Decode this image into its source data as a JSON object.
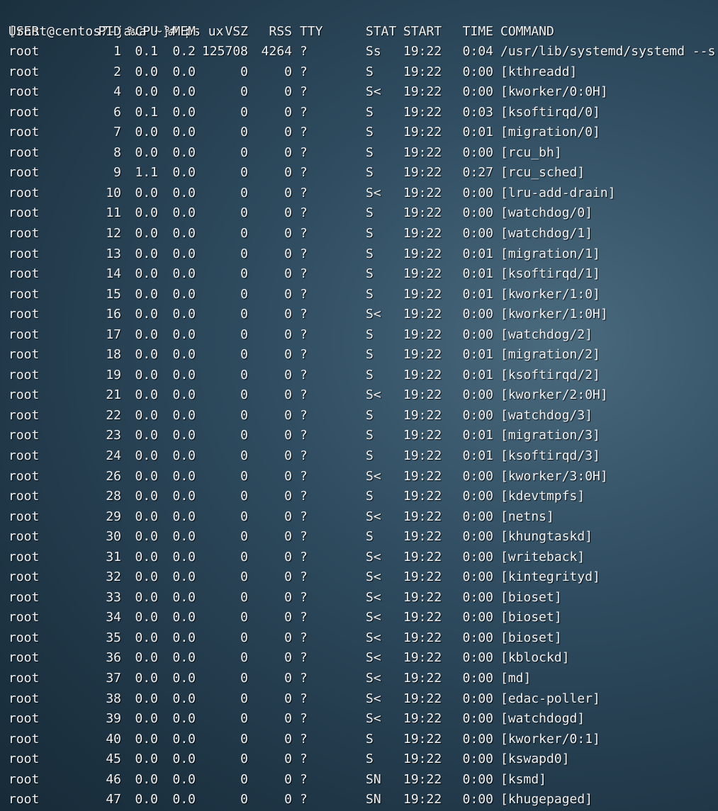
{
  "prompt": "[root@centos7-java ~]# ps ux",
  "headers": {
    "user": "USER",
    "pid": "PID",
    "cpu": "%CPU",
    "mem": "%MEM",
    "vsz": "VSZ",
    "rss": "RSS",
    "tty": "TTY",
    "stat": "STAT",
    "start": "START",
    "time": "TIME",
    "command": "COMMAND"
  },
  "rows": [
    {
      "user": "root",
      "pid": "1",
      "cpu": "0.1",
      "mem": "0.2",
      "vsz": "125708",
      "rss": "4264",
      "tty": "?",
      "stat": "Ss",
      "start": "19:22",
      "time": "0:04",
      "command": "/usr/lib/systemd/systemd --s"
    },
    {
      "user": "root",
      "pid": "2",
      "cpu": "0.0",
      "mem": "0.0",
      "vsz": "0",
      "rss": "0",
      "tty": "?",
      "stat": "S",
      "start": "19:22",
      "time": "0:00",
      "command": "[kthreadd]"
    },
    {
      "user": "root",
      "pid": "4",
      "cpu": "0.0",
      "mem": "0.0",
      "vsz": "0",
      "rss": "0",
      "tty": "?",
      "stat": "S<",
      "start": "19:22",
      "time": "0:00",
      "command": "[kworker/0:0H]"
    },
    {
      "user": "root",
      "pid": "6",
      "cpu": "0.1",
      "mem": "0.0",
      "vsz": "0",
      "rss": "0",
      "tty": "?",
      "stat": "S",
      "start": "19:22",
      "time": "0:03",
      "command": "[ksoftirqd/0]"
    },
    {
      "user": "root",
      "pid": "7",
      "cpu": "0.0",
      "mem": "0.0",
      "vsz": "0",
      "rss": "0",
      "tty": "?",
      "stat": "S",
      "start": "19:22",
      "time": "0:01",
      "command": "[migration/0]"
    },
    {
      "user": "root",
      "pid": "8",
      "cpu": "0.0",
      "mem": "0.0",
      "vsz": "0",
      "rss": "0",
      "tty": "?",
      "stat": "S",
      "start": "19:22",
      "time": "0:00",
      "command": "[rcu_bh]"
    },
    {
      "user": "root",
      "pid": "9",
      "cpu": "1.1",
      "mem": "0.0",
      "vsz": "0",
      "rss": "0",
      "tty": "?",
      "stat": "S",
      "start": "19:22",
      "time": "0:27",
      "command": "[rcu_sched]"
    },
    {
      "user": "root",
      "pid": "10",
      "cpu": "0.0",
      "mem": "0.0",
      "vsz": "0",
      "rss": "0",
      "tty": "?",
      "stat": "S<",
      "start": "19:22",
      "time": "0:00",
      "command": "[lru-add-drain]"
    },
    {
      "user": "root",
      "pid": "11",
      "cpu": "0.0",
      "mem": "0.0",
      "vsz": "0",
      "rss": "0",
      "tty": "?",
      "stat": "S",
      "start": "19:22",
      "time": "0:00",
      "command": "[watchdog/0]"
    },
    {
      "user": "root",
      "pid": "12",
      "cpu": "0.0",
      "mem": "0.0",
      "vsz": "0",
      "rss": "0",
      "tty": "?",
      "stat": "S",
      "start": "19:22",
      "time": "0:00",
      "command": "[watchdog/1]"
    },
    {
      "user": "root",
      "pid": "13",
      "cpu": "0.0",
      "mem": "0.0",
      "vsz": "0",
      "rss": "0",
      "tty": "?",
      "stat": "S",
      "start": "19:22",
      "time": "0:01",
      "command": "[migration/1]"
    },
    {
      "user": "root",
      "pid": "14",
      "cpu": "0.0",
      "mem": "0.0",
      "vsz": "0",
      "rss": "0",
      "tty": "?",
      "stat": "S",
      "start": "19:22",
      "time": "0:01",
      "command": "[ksoftirqd/1]"
    },
    {
      "user": "root",
      "pid": "15",
      "cpu": "0.0",
      "mem": "0.0",
      "vsz": "0",
      "rss": "0",
      "tty": "?",
      "stat": "S",
      "start": "19:22",
      "time": "0:01",
      "command": "[kworker/1:0]"
    },
    {
      "user": "root",
      "pid": "16",
      "cpu": "0.0",
      "mem": "0.0",
      "vsz": "0",
      "rss": "0",
      "tty": "?",
      "stat": "S<",
      "start": "19:22",
      "time": "0:00",
      "command": "[kworker/1:0H]"
    },
    {
      "user": "root",
      "pid": "17",
      "cpu": "0.0",
      "mem": "0.0",
      "vsz": "0",
      "rss": "0",
      "tty": "?",
      "stat": "S",
      "start": "19:22",
      "time": "0:00",
      "command": "[watchdog/2]"
    },
    {
      "user": "root",
      "pid": "18",
      "cpu": "0.0",
      "mem": "0.0",
      "vsz": "0",
      "rss": "0",
      "tty": "?",
      "stat": "S",
      "start": "19:22",
      "time": "0:01",
      "command": "[migration/2]"
    },
    {
      "user": "root",
      "pid": "19",
      "cpu": "0.0",
      "mem": "0.0",
      "vsz": "0",
      "rss": "0",
      "tty": "?",
      "stat": "S",
      "start": "19:22",
      "time": "0:01",
      "command": "[ksoftirqd/2]"
    },
    {
      "user": "root",
      "pid": "21",
      "cpu": "0.0",
      "mem": "0.0",
      "vsz": "0",
      "rss": "0",
      "tty": "?",
      "stat": "S<",
      "start": "19:22",
      "time": "0:00",
      "command": "[kworker/2:0H]"
    },
    {
      "user": "root",
      "pid": "22",
      "cpu": "0.0",
      "mem": "0.0",
      "vsz": "0",
      "rss": "0",
      "tty": "?",
      "stat": "S",
      "start": "19:22",
      "time": "0:00",
      "command": "[watchdog/3]"
    },
    {
      "user": "root",
      "pid": "23",
      "cpu": "0.0",
      "mem": "0.0",
      "vsz": "0",
      "rss": "0",
      "tty": "?",
      "stat": "S",
      "start": "19:22",
      "time": "0:01",
      "command": "[migration/3]"
    },
    {
      "user": "root",
      "pid": "24",
      "cpu": "0.0",
      "mem": "0.0",
      "vsz": "0",
      "rss": "0",
      "tty": "?",
      "stat": "S",
      "start": "19:22",
      "time": "0:01",
      "command": "[ksoftirqd/3]"
    },
    {
      "user": "root",
      "pid": "26",
      "cpu": "0.0",
      "mem": "0.0",
      "vsz": "0",
      "rss": "0",
      "tty": "?",
      "stat": "S<",
      "start": "19:22",
      "time": "0:00",
      "command": "[kworker/3:0H]"
    },
    {
      "user": "root",
      "pid": "28",
      "cpu": "0.0",
      "mem": "0.0",
      "vsz": "0",
      "rss": "0",
      "tty": "?",
      "stat": "S",
      "start": "19:22",
      "time": "0:00",
      "command": "[kdevtmpfs]"
    },
    {
      "user": "root",
      "pid": "29",
      "cpu": "0.0",
      "mem": "0.0",
      "vsz": "0",
      "rss": "0",
      "tty": "?",
      "stat": "S<",
      "start": "19:22",
      "time": "0:00",
      "command": "[netns]"
    },
    {
      "user": "root",
      "pid": "30",
      "cpu": "0.0",
      "mem": "0.0",
      "vsz": "0",
      "rss": "0",
      "tty": "?",
      "stat": "S",
      "start": "19:22",
      "time": "0:00",
      "command": "[khungtaskd]"
    },
    {
      "user": "root",
      "pid": "31",
      "cpu": "0.0",
      "mem": "0.0",
      "vsz": "0",
      "rss": "0",
      "tty": "?",
      "stat": "S<",
      "start": "19:22",
      "time": "0:00",
      "command": "[writeback]"
    },
    {
      "user": "root",
      "pid": "32",
      "cpu": "0.0",
      "mem": "0.0",
      "vsz": "0",
      "rss": "0",
      "tty": "?",
      "stat": "S<",
      "start": "19:22",
      "time": "0:00",
      "command": "[kintegrityd]"
    },
    {
      "user": "root",
      "pid": "33",
      "cpu": "0.0",
      "mem": "0.0",
      "vsz": "0",
      "rss": "0",
      "tty": "?",
      "stat": "S<",
      "start": "19:22",
      "time": "0:00",
      "command": "[bioset]"
    },
    {
      "user": "root",
      "pid": "34",
      "cpu": "0.0",
      "mem": "0.0",
      "vsz": "0",
      "rss": "0",
      "tty": "?",
      "stat": "S<",
      "start": "19:22",
      "time": "0:00",
      "command": "[bioset]"
    },
    {
      "user": "root",
      "pid": "35",
      "cpu": "0.0",
      "mem": "0.0",
      "vsz": "0",
      "rss": "0",
      "tty": "?",
      "stat": "S<",
      "start": "19:22",
      "time": "0:00",
      "command": "[bioset]"
    },
    {
      "user": "root",
      "pid": "36",
      "cpu": "0.0",
      "mem": "0.0",
      "vsz": "0",
      "rss": "0",
      "tty": "?",
      "stat": "S<",
      "start": "19:22",
      "time": "0:00",
      "command": "[kblockd]"
    },
    {
      "user": "root",
      "pid": "37",
      "cpu": "0.0",
      "mem": "0.0",
      "vsz": "0",
      "rss": "0",
      "tty": "?",
      "stat": "S<",
      "start": "19:22",
      "time": "0:00",
      "command": "[md]"
    },
    {
      "user": "root",
      "pid": "38",
      "cpu": "0.0",
      "mem": "0.0",
      "vsz": "0",
      "rss": "0",
      "tty": "?",
      "stat": "S<",
      "start": "19:22",
      "time": "0:00",
      "command": "[edac-poller]"
    },
    {
      "user": "root",
      "pid": "39",
      "cpu": "0.0",
      "mem": "0.0",
      "vsz": "0",
      "rss": "0",
      "tty": "?",
      "stat": "S<",
      "start": "19:22",
      "time": "0:00",
      "command": "[watchdogd]"
    },
    {
      "user": "root",
      "pid": "40",
      "cpu": "0.0",
      "mem": "0.0",
      "vsz": "0",
      "rss": "0",
      "tty": "?",
      "stat": "S",
      "start": "19:22",
      "time": "0:00",
      "command": "[kworker/0:1]"
    },
    {
      "user": "root",
      "pid": "45",
      "cpu": "0.0",
      "mem": "0.0",
      "vsz": "0",
      "rss": "0",
      "tty": "?",
      "stat": "S",
      "start": "19:22",
      "time": "0:00",
      "command": "[kswapd0]"
    },
    {
      "user": "root",
      "pid": "46",
      "cpu": "0.0",
      "mem": "0.0",
      "vsz": "0",
      "rss": "0",
      "tty": "?",
      "stat": "SN",
      "start": "19:22",
      "time": "0:00",
      "command": "[ksmd]"
    },
    {
      "user": "root",
      "pid": "47",
      "cpu": "0.0",
      "mem": "0.0",
      "vsz": "0",
      "rss": "0",
      "tty": "?",
      "stat": "SN",
      "start": "19:22",
      "time": "0:00",
      "command": "[khugepaged]"
    }
  ]
}
